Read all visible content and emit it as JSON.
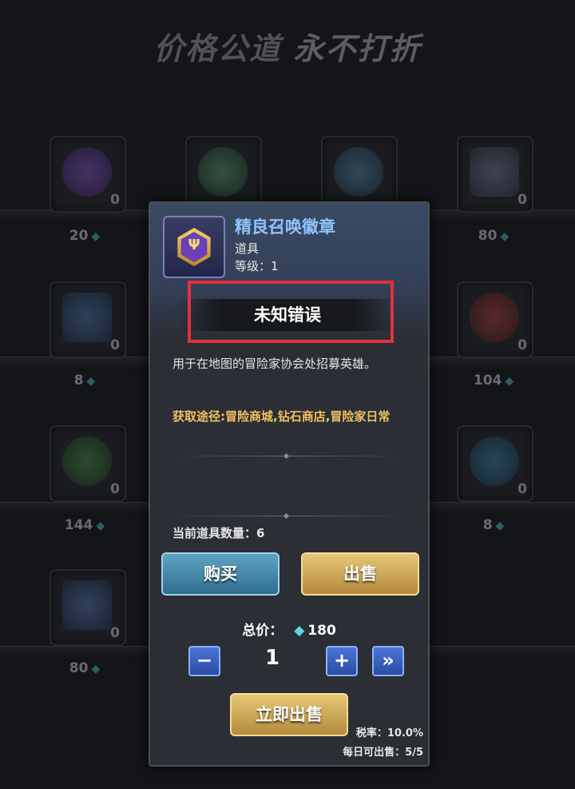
{
  "shop": {
    "title_part1": "价格公道",
    "title_part2": "永不打折",
    "rows": [
      {
        "counts": [
          "0",
          "",
          "",
          "0"
        ],
        "prices": [
          "20",
          "",
          "",
          "80"
        ]
      },
      {
        "counts": [
          "0",
          "",
          "",
          "0"
        ],
        "prices": [
          "8",
          "",
          "",
          "104"
        ]
      },
      {
        "counts": [
          "0",
          "",
          "",
          "0"
        ],
        "prices": [
          "144",
          "",
          "",
          "8"
        ]
      },
      {
        "counts": [
          "0"
        ],
        "prices": [
          "80"
        ]
      }
    ]
  },
  "popup": {
    "item_name": "精良召唤徽章",
    "item_type": "道具",
    "item_level": "等级：1",
    "error_text": "未知错误",
    "description": "用于在地图的冒险家协会处招募英雄。",
    "source": "获取途径:冒险商城,钻石商店,冒险家日常",
    "quantity_label": "当前道具数量：6",
    "buy_label": "购买",
    "sell_label": "出售",
    "total_label": "总价：",
    "total_value": "180",
    "quantity_value": "1",
    "minus_symbol": "−",
    "plus_symbol": "+",
    "max_symbol": "»",
    "sell_now_label": "立即出售",
    "tax_text": "税率：10.0%",
    "daily_text": "每日可出售：5/5"
  },
  "colors": {
    "error_frame": "#e0313c",
    "source_text": "#f0c060",
    "item_name": "#8fc3ff"
  }
}
